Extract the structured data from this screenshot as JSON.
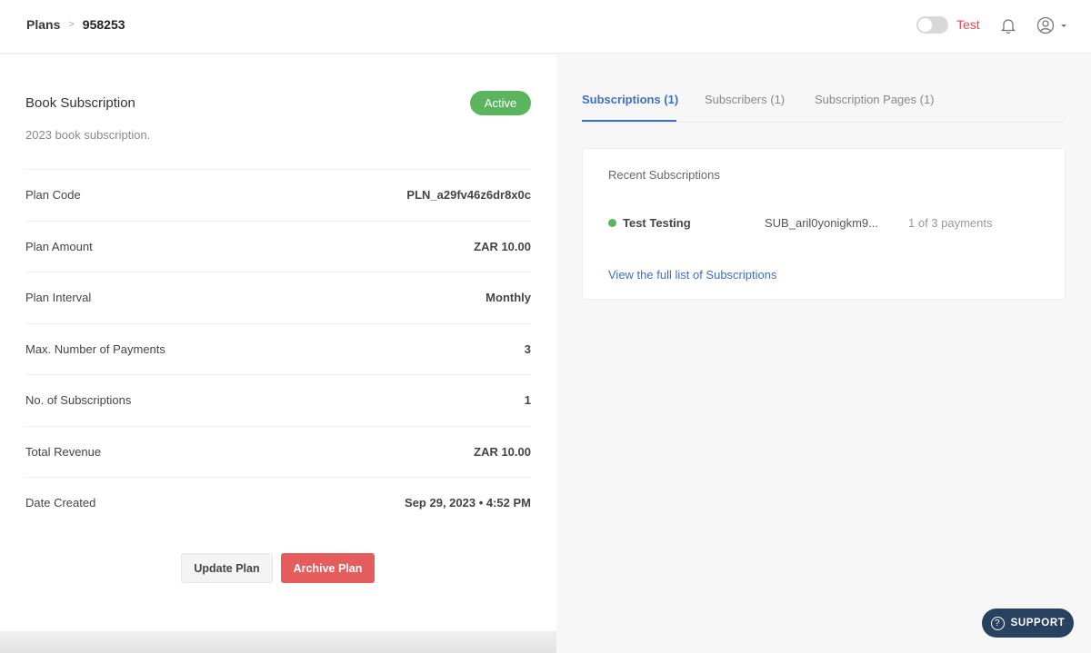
{
  "header": {
    "breadcrumb_root": "Plans",
    "breadcrumb_separator": ">",
    "breadcrumb_current": "958253",
    "mode_label": "Test",
    "mode_enabled": false,
    "bell_icon": "bell-icon",
    "account_icon": "user-circle-icon"
  },
  "plan": {
    "title": "Book Subscription",
    "status": "Active",
    "description": "2023 book subscription.",
    "details": [
      {
        "label": "Plan Code",
        "value": "PLN_a29fv46z6dr8x0c"
      },
      {
        "label": "Plan Amount",
        "value": "ZAR 10.00"
      },
      {
        "label": "Plan Interval",
        "value": "Monthly"
      },
      {
        "label": "Max. Number of Payments",
        "value": "3"
      },
      {
        "label": "No. of Subscriptions",
        "value": "1"
      },
      {
        "label": "Total Revenue",
        "value": "ZAR 10.00"
      },
      {
        "label": "Date Created",
        "value": "Sep 29, 2023 • 4:52 PM"
      }
    ],
    "update_button": "Update Plan",
    "archive_button": "Archive Plan"
  },
  "tabs": [
    {
      "label": "Subscriptions (1)",
      "active": true
    },
    {
      "label": "Subscribers (1)",
      "active": false
    },
    {
      "label": "Subscription Pages (1)",
      "active": false
    }
  ],
  "recent": {
    "title": "Recent Subscriptions",
    "items": [
      {
        "name": "Test Testing",
        "code": "SUB_aril0yonigkm9...",
        "payments": "1 of 3 payments",
        "status_color": "#5ab55e"
      }
    ],
    "view_all": "View the full list of Subscriptions"
  },
  "support": {
    "label": "SUPPORT",
    "icon": "question-circle-icon"
  },
  "colors": {
    "accent": "#3f6fc5",
    "active": "#5ab55e",
    "danger": "#e45c5c",
    "test": "#e5484d",
    "support_bg": "#27415f"
  }
}
